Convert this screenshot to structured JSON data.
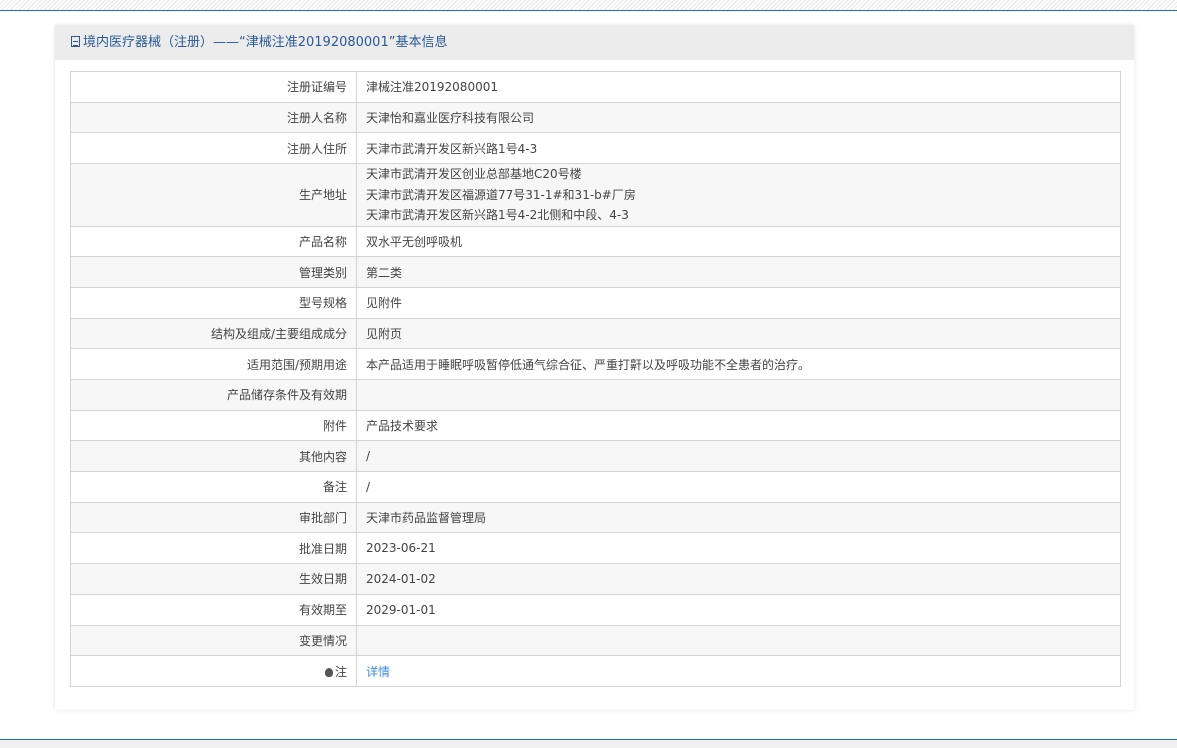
{
  "header": {
    "title": "境内医疗器械（注册）——“津械注准20192080001”基本信息",
    "icon": "document-icon"
  },
  "rows": [
    {
      "label": "注册证编号",
      "value": "津械注准20192080001"
    },
    {
      "label": "注册人名称",
      "value": "天津怡和嘉业医疗科技有限公司"
    },
    {
      "label": "注册人住所",
      "value": "天津市武清开发区新兴路1号4-3"
    },
    {
      "label": "生产地址",
      "lines": [
        "天津市武清开发区创业总部基地C20号楼",
        "天津市武清开发区福源道77号31-1#和31-b#厂房",
        "天津市武清开发区新兴路1号4-2北侧和中段、4-3"
      ]
    },
    {
      "label": "产品名称",
      "value": "双水平无创呼吸机"
    },
    {
      "label": "管理类别",
      "value": "第二类"
    },
    {
      "label": "型号规格",
      "value": "见附件"
    },
    {
      "label": "结构及组成/主要组成成分",
      "value": "见附页"
    },
    {
      "label": "适用范围/预期用途",
      "value": "本产品适用于睡眠呼吸暂停低通气综合征、严重打鼾以及呼吸功能不全患者的治疗。"
    },
    {
      "label": "产品储存条件及有效期",
      "value": ""
    },
    {
      "label": "附件",
      "value": "产品技术要求"
    },
    {
      "label": "其他内容",
      "value": "/"
    },
    {
      "label": "备注",
      "value": "/"
    },
    {
      "label": "审批部门",
      "value": "天津市药品监督管理局"
    },
    {
      "label": "批准日期",
      "value": "2023-06-21"
    },
    {
      "label": "生效日期",
      "value": "2024-01-02"
    },
    {
      "label": "有效期至",
      "value": "2029-01-01"
    },
    {
      "label": "变更情况",
      "value": ""
    },
    {
      "label": "注",
      "value": "详情",
      "icon": "bulb-icon"
    }
  ]
}
